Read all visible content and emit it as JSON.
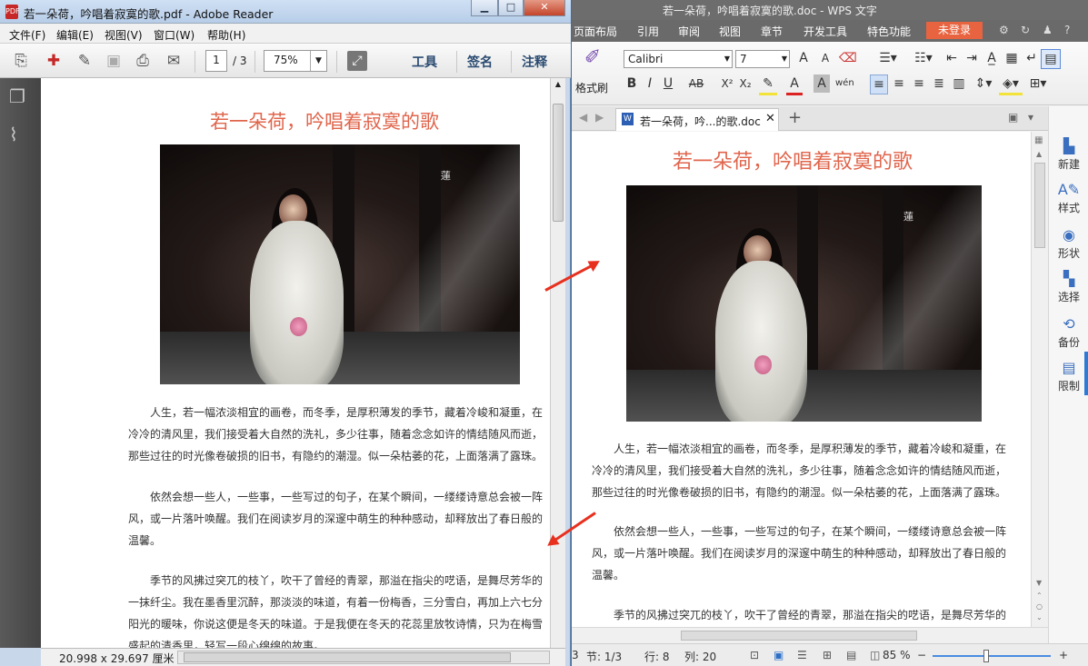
{
  "reader": {
    "title": "若一朵荷，吟唱着寂寞的歌.pdf - Adobe Reader",
    "menu": [
      "文件(F)",
      "编辑(E)",
      "视图(V)",
      "窗口(W)",
      "帮助(H)"
    ],
    "page_current": "1",
    "page_total": "/ 3",
    "zoom": "75%",
    "tools": [
      "工具",
      "签名",
      "注释"
    ],
    "status_size": "20.998 x 29.697 厘米",
    "pdf_label": "PDF"
  },
  "doc": {
    "title": "若一朵荷，吟唱着寂寞的歌",
    "stamp": "蓮",
    "p1": "人生，若一幅浓淡相宜的画卷，而冬季，是厚积薄发的季节，藏着冷峻和凝重，在冷冷的清风里，我们接受着大自然的洗礼，多少往事，随着念念如许的情结随风而逝，那些过往的时光像卷破损的旧书，有隐约的潮湿。似一朵枯萎的花，上面落满了露珠。",
    "p2": "依然会想一些人，一些事，一些写过的句子，在某个瞬间，一缕缕诗意总会被一阵风，或一片落叶唤醒。我们在阅读岁月的深邃中萌生的种种感动，却释放出了春日般的温馨。",
    "p3": "季节的风拂过突兀的枝丫，吹干了曾经的青翠，那溢在指尖的呓语，是舞尽芳华的一抹纤尘。我在墨香里沉醉，那淡淡的味道，有着一份梅香，三分雪白，再加上六七分阳光的暖味，你说这便是冬天的味道。于是我便在冬天的花蕊里放牧诗情，只为在梅雪盛起的清香里，轻写一段心绵绵的故事。",
    "p3_wps": "季节的风拂过突兀的枝丫，吹干了曾经的青翠，那溢在指尖的呓语，是舞尽芳华的"
  },
  "wps": {
    "title": "若一朵荷，吟唱着寂寞的歌.doc - WPS 文字",
    "menu": [
      "页面布局",
      "引用",
      "审阅",
      "视图",
      "章节",
      "开发工具",
      "特色功能"
    ],
    "login": "未登录",
    "format_painter": "格式刷",
    "font": "Calibri",
    "size": "7",
    "doc_tab": "若一朵荷，吟...的歌.doc",
    "side": [
      "新建",
      "样式",
      "形状",
      "选择",
      "备份",
      "限制"
    ],
    "status": {
      "section": "节: 1/3",
      "row": "行: 8",
      "col": "列: 20",
      "zoom": "85 %",
      "page_frag": "3"
    }
  }
}
